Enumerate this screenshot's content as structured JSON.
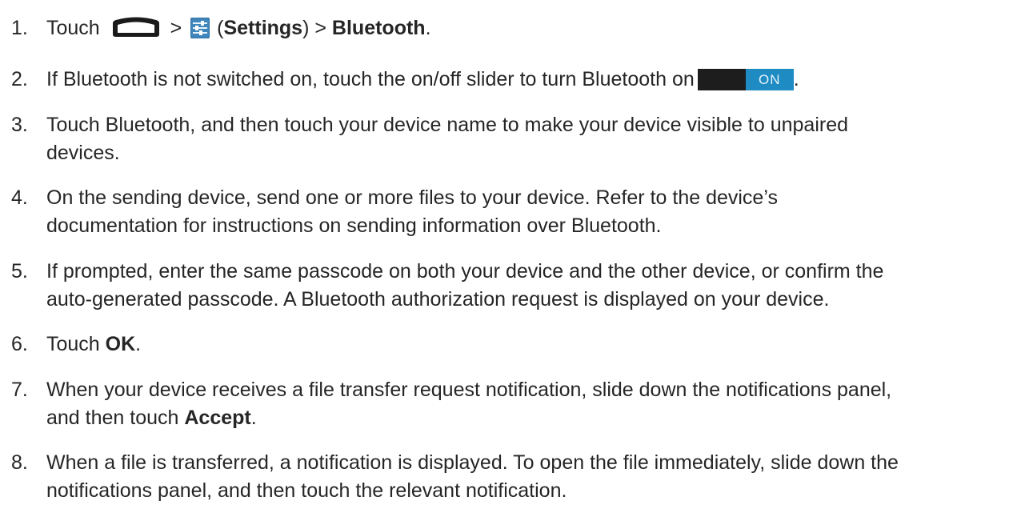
{
  "steps": [
    {
      "num": "1.",
      "text_touch": "Touch",
      "sep1": ">",
      "open_paren": "(",
      "settings_bold": "Settings",
      "close_paren_sep": ") >",
      "bluetooth_bold": "Bluetooth",
      "period": ".",
      "icons": [
        "home-icon",
        "settings-icon"
      ]
    },
    {
      "num": "2.",
      "text": "If Bluetooth is not switched on, touch the on/off slider to turn Bluetooth on",
      "slider_label": "ON",
      "period": "."
    },
    {
      "num": "3.",
      "line1": "Touch Bluetooth, and then touch your device name to make your device visible to unpaired",
      "line2": "devices."
    },
    {
      "num": "4.",
      "line1": "On the sending device, send one or more files to your device. Refer to the device’s",
      "line2": "documentation for instructions on sending information over Bluetooth."
    },
    {
      "num": "5.",
      "line1": "If prompted, enter the same passcode on both your device and the other device, or confirm the",
      "line2": "auto-generated passcode. A Bluetooth authorization request is displayed on your device."
    },
    {
      "num": "6.",
      "text": "Touch",
      "bold": "OK",
      "period": "."
    },
    {
      "num": "7.",
      "line1": "When your device receives a file transfer request notification, slide down the notifications panel,",
      "line2_prefix": "and then touch",
      "line2_bold": "Accept",
      "period": "."
    },
    {
      "num": "8.",
      "line1": "When a file is transferred, a notification is displayed. To open the file immediately, slide down the",
      "line2": "notifications panel, and then touch the relevant notification."
    }
  ],
  "colors": {
    "text": "#262626",
    "slider_on": "#1e8bc3",
    "slider_off": "#1d1d1d"
  }
}
